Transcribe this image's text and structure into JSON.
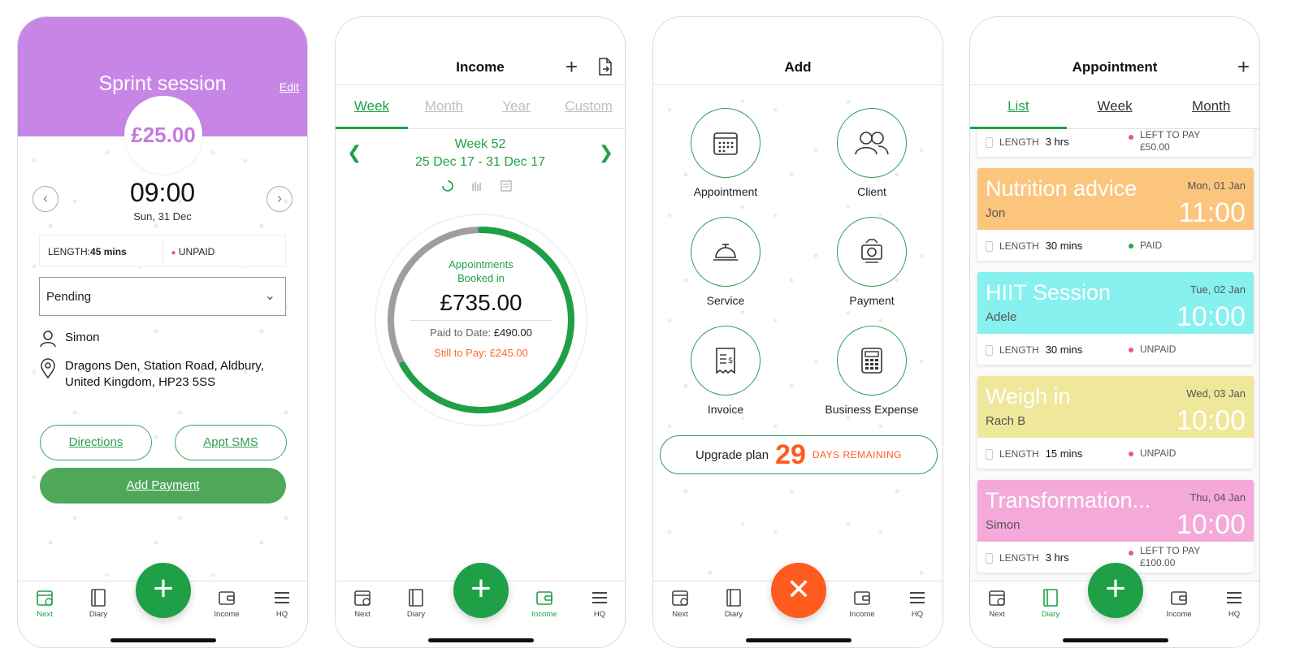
{
  "bottom_nav": {
    "next": "Next",
    "diary": "Diary",
    "income": "Income",
    "hq": "HQ"
  },
  "phone1": {
    "title": "Sprint session",
    "edit": "Edit",
    "price": "£25.00",
    "time": "09:00",
    "date": "Sun, 31 Dec",
    "length_label": "LENGTH:",
    "length_value": "45 mins",
    "status": "UNPAID",
    "select_value": "Pending",
    "client": "Simon",
    "address_line1": "Dragons Den, Station Road, Aldbury,",
    "address_line2": "United Kingdom, HP23 5SS",
    "directions": "Directions",
    "sms": "Appt SMS",
    "add_payment": "Add Payment",
    "colors": {
      "header": "#c786e6",
      "accent": "#4fa85a"
    }
  },
  "phone2": {
    "title": "Income",
    "tabs": [
      "Week",
      "Month",
      "Year",
      "Custom"
    ],
    "week_label": "Week 52",
    "week_range": "25 Dec 17 - 31 Dec 17",
    "booked_line1": "Appointments",
    "booked_line2": "Booked in",
    "amount": "£735.00",
    "paid_label": "Paid to Date: ",
    "paid_value": "£490.00",
    "still_to_pay": "Still to Pay: £245.00",
    "paid_fraction": 0.6667
  },
  "phone3": {
    "title": "Add",
    "items": [
      "Appointment",
      "Client",
      "Service",
      "Payment",
      "Invoice",
      "Business Expense"
    ],
    "upgrade_label": "Upgrade plan",
    "days_number": "29",
    "days_text": "DAYS REMAINING"
  },
  "phone4": {
    "title": "Appointment",
    "tabs": [
      "List",
      "Week",
      "Month"
    ],
    "length_label": "LENGTH",
    "partial": {
      "length": "3 hrs",
      "status1": "LEFT TO PAY",
      "status2": "£50.00"
    },
    "cards": [
      {
        "name": "Nutrition advice",
        "client": "Jon",
        "date": "Mon, 01 Jan",
        "time": "11:00",
        "length": "30 mins",
        "status": "PAID",
        "color": "#fbc57d",
        "dot": "#27a546"
      },
      {
        "name": "HIIT Session",
        "client": "Adele",
        "date": "Tue, 02 Jan",
        "time": "10:00",
        "length": "30 mins",
        "status": "UNPAID",
        "color": "#86f1ef",
        "dot": "#e85b6a"
      },
      {
        "name": "Weigh in",
        "client": "Rach B",
        "date": "Wed, 03 Jan",
        "time": "10:00",
        "length": "15 mins",
        "status": "UNPAID",
        "color": "#efe79a",
        "dot": "#e85b6a"
      },
      {
        "name": "Transformation...",
        "client": "Simon",
        "date": "Thu, 04 Jan",
        "time": "10:00",
        "length": "3 hrs",
        "status": "LEFT TO PAY",
        "status2": "£100.00",
        "color": "#f4a9d9",
        "dot": "#e85b6a"
      }
    ]
  }
}
